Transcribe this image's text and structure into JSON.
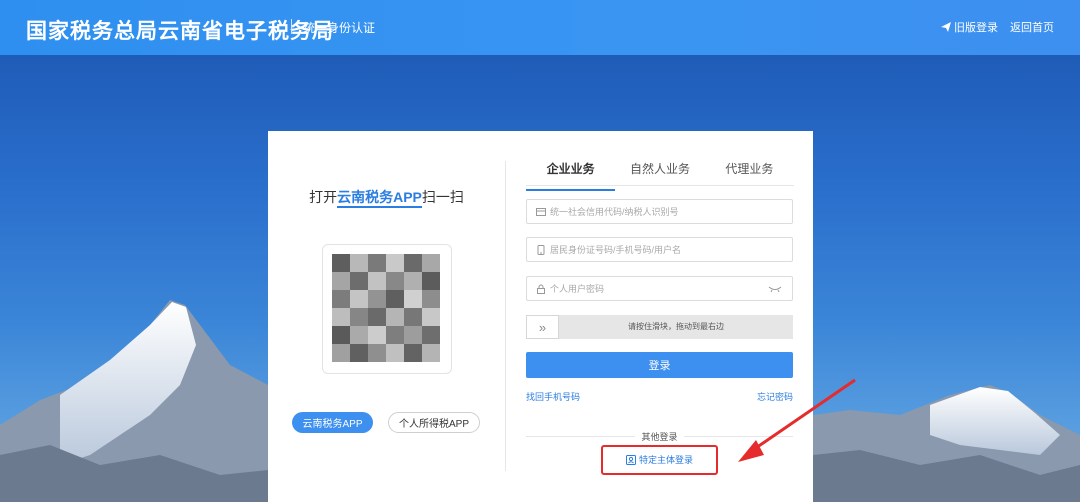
{
  "header": {
    "title": "国家税务总局云南省电子税务局",
    "subtitle": "统一身份认证",
    "links": {
      "old_login": "旧版登录",
      "home": "返回首页"
    }
  },
  "scan": {
    "prefix": "打开",
    "app_name": "云南税务APP",
    "suffix": "扫一扫",
    "btn_primary": "云南税务APP",
    "btn_secondary": "个人所得税APP"
  },
  "tabs": [
    "企业业务",
    "自然人业务",
    "代理业务"
  ],
  "form": {
    "credit_code_placeholder": "统一社会信用代码/纳税人识别号",
    "id_placeholder": "居民身份证号码/手机号码/用户名",
    "password_placeholder": "个人用户密码",
    "slider_text": "请按住滑块，拖动到最右边",
    "slider_handle": "»",
    "login": "登录",
    "forgot_phone": "找回手机号码",
    "forgot_password": "忘记密码",
    "other_login": "其他登录",
    "special_login": "特定主体登录"
  },
  "colors": {
    "accent": "#3d8ff0",
    "highlight": "#e52b2b"
  }
}
